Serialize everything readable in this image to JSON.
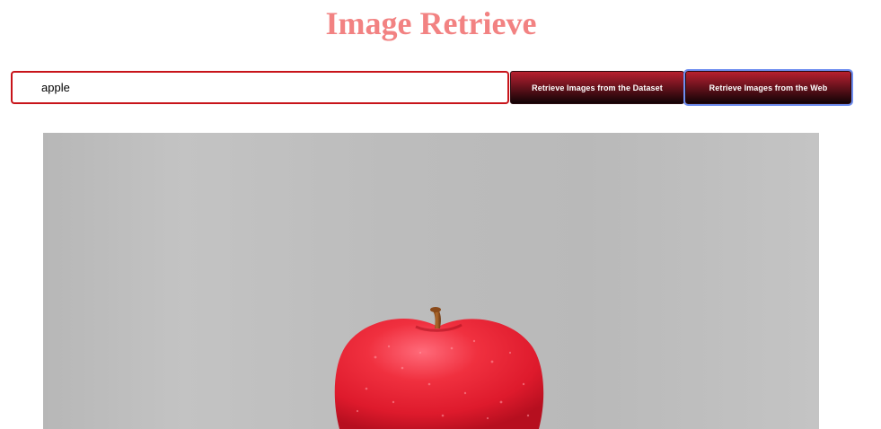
{
  "header": {
    "title": "Image Retrieve"
  },
  "search": {
    "value": "apple",
    "placeholder": ""
  },
  "actions": {
    "dataset_label": "Retrieve Images from the Dataset",
    "web_label": "Retrieve Images from the Web"
  },
  "results": {
    "image_subject": "red apple on gray background",
    "image_alt": "apple"
  },
  "colors": {
    "title": "#f28282",
    "input_border": "#c8141a",
    "button_top": "#b8202e",
    "button_bottom": "#120306",
    "focus_ring": "#6f8ef0",
    "image_background": "#bdbdbd",
    "apple_red": "#e8243a"
  }
}
